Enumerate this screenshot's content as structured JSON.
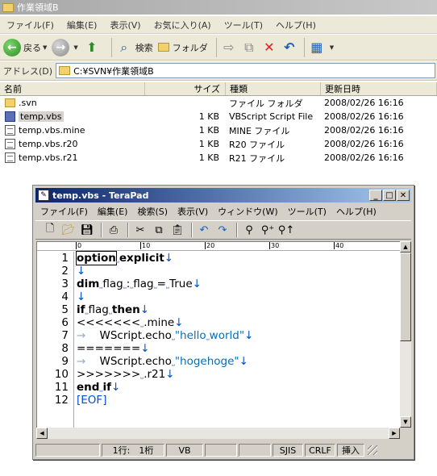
{
  "explorer": {
    "title": "作業領域B",
    "menu": [
      "ファイル(F)",
      "編集(E)",
      "表示(V)",
      "お気に入り(A)",
      "ツール(T)",
      "ヘルプ(H)"
    ],
    "toolbar": {
      "back": "戻る",
      "search": "検索",
      "folders": "フォルダ"
    },
    "address_label": "アドレス(D)",
    "address": "C:¥SVN¥作業領域B",
    "columns": {
      "name": "名前",
      "size": "サイズ",
      "type": "種類",
      "date": "更新日時"
    },
    "files": [
      {
        "name": ".svn",
        "size": "",
        "type": "ファイル フォルダ",
        "date": "2008/02/26 16:16",
        "icon": "folder-icon"
      },
      {
        "name": "temp.vbs",
        "size": "1 KB",
        "type": "VBScript Script File",
        "date": "2008/02/26 16:16",
        "icon": "vbs-file-icon"
      },
      {
        "name": "temp.vbs.mine",
        "size": "1 KB",
        "type": "MINE ファイル",
        "date": "2008/02/26 16:16",
        "icon": "document-icon"
      },
      {
        "name": "temp.vbs.r20",
        "size": "1 KB",
        "type": "R20 ファイル",
        "date": "2008/02/26 16:16",
        "icon": "document-icon"
      },
      {
        "name": "temp.vbs.r21",
        "size": "1 KB",
        "type": "R21 ファイル",
        "date": "2008/02/26 16:16",
        "icon": "document-icon"
      }
    ]
  },
  "terapad": {
    "title": "temp.vbs - TeraPad",
    "menu": [
      "ファイル(F)",
      "編集(E)",
      "検索(S)",
      "表示(V)",
      "ウィンドウ(W)",
      "ツール(T)",
      "ヘルプ(H)"
    ],
    "ruler": [
      "0",
      "10",
      "20",
      "30",
      "40"
    ],
    "line_numbers": [
      "1",
      "2",
      "3",
      "4",
      "5",
      "6",
      "7",
      "8",
      "9",
      "10",
      "11",
      "12"
    ],
    "code_lines": [
      [
        "option",
        " ",
        "explicit"
      ],
      [],
      [
        "dim",
        " ",
        "flag",
        " ",
        ":",
        " ",
        "flag",
        " ",
        "=",
        " ",
        "True"
      ],
      [],
      [
        "if",
        " ",
        "flag",
        " ",
        "then"
      ],
      [
        "<<<<<<<",
        " ",
        ".mine"
      ],
      [
        "→",
        "WScript.echo",
        " ",
        "\"hello",
        " ",
        "world\""
      ],
      [
        "======="
      ],
      [
        "→",
        "WScript.echo",
        " ",
        "\"hogehoge\""
      ],
      [
        ">>>>>>>",
        " ",
        ".r21"
      ],
      [
        "end",
        " ",
        "if"
      ],
      [
        "[EOF]"
      ]
    ],
    "status": {
      "pos": "1行:　1桁",
      "lang": "VB",
      "encoding": "SJIS",
      "newline": "CRLF",
      "mode": "挿入"
    },
    "colors": {
      "title_start": "#0a246a",
      "title_end": "#a6caf0",
      "marker": "#0050c8"
    }
  }
}
